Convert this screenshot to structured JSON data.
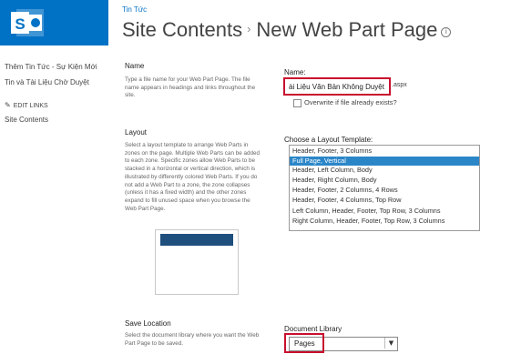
{
  "header": {
    "site_link": "Tin Tức",
    "title_parent": "Site Contents",
    "separator": "›",
    "title_current": "New Web Part Page",
    "info_icon_glyph": "i"
  },
  "nav": {
    "items": [
      {
        "label": "Thêm Tin Tức - Sự Kiện Mới"
      },
      {
        "label": "Tin và Tài Liệu Chờ Duyệt"
      }
    ],
    "edit_links": "EDIT LINKS",
    "site_contents": "Site Contents"
  },
  "name_section": {
    "title": "Name",
    "description": "Type a file name for your Web Part Page. The file name appears in headings and links throughout the site.",
    "field_label": "Name:",
    "field_value": "ài Liệu Văn Bản Không Duyệt",
    "extension": ".aspx",
    "overwrite_label": "Overwrite if file already exists?"
  },
  "layout_section": {
    "title": "Layout",
    "description": "Select a layout template to arrange Web Parts in zones on the page. Multiple Web Parts can be added to each zone. Specific zones allow Web Parts to be stacked in a horizontal or vertical direction, which is illustrated by differently colored Web Parts. If you do not add a Web Part to a zone, the zone collapses (unless it has a fixed width) and the other zones expand to fill unused space when you browse the Web Part Page.",
    "list_label": "Choose a Layout Template:",
    "templates": [
      {
        "label": "Header, Footer, 3 Columns"
      },
      {
        "label": "Full Page, Vertical"
      },
      {
        "label": "Header, Left Column, Body"
      },
      {
        "label": "Header, Right Column, Body"
      },
      {
        "label": "Header, Footer, 2 Columns, 4 Rows"
      },
      {
        "label": "Header, Footer, 4 Columns, Top Row"
      },
      {
        "label": "Left Column, Header, Footer, Top Row, 3 Columns"
      },
      {
        "label": "Right Column, Header, Footer, Top Row, 3 Columns"
      }
    ],
    "selected_index": 1
  },
  "save_section": {
    "title": "Save Location",
    "description": "Select the document library where you want the Web Part Page to be saved.",
    "library_label": "Document Library",
    "library_value": "Pages"
  },
  "colors": {
    "brand": "#0072c6",
    "selection": "#2b86c8",
    "highlight": "#c8102e",
    "preview_bar": "#1f4f7d"
  }
}
